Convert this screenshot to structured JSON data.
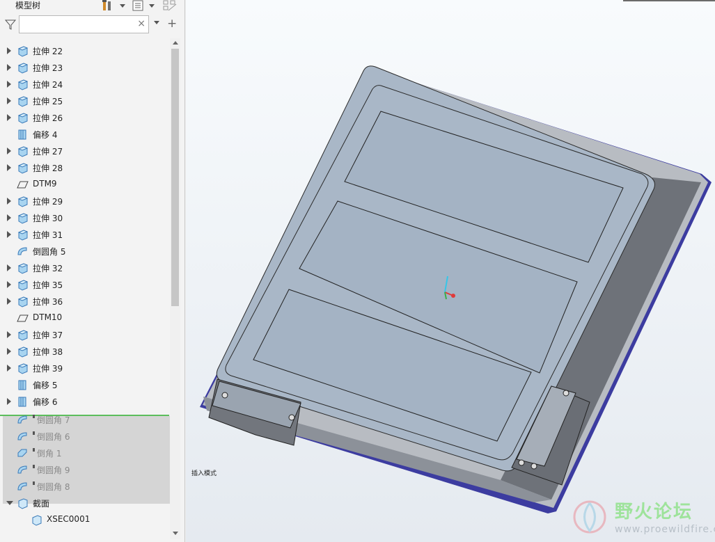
{
  "panel": {
    "title": "模型树",
    "search": {
      "value": "",
      "placeholder": ""
    }
  },
  "tree": [
    {
      "label": "拉伸 22",
      "icon": "extrude-icon",
      "expand": "right"
    },
    {
      "label": "拉伸 23",
      "icon": "extrude-icon",
      "expand": "right"
    },
    {
      "label": "拉伸 24",
      "icon": "extrude-icon",
      "expand": "right"
    },
    {
      "label": "拉伸 25",
      "icon": "extrude-icon",
      "expand": "right"
    },
    {
      "label": "拉伸 26",
      "icon": "extrude-icon",
      "expand": "right"
    },
    {
      "label": "偏移 4",
      "icon": "offset-icon",
      "expand": "none"
    },
    {
      "label": "拉伸 27",
      "icon": "extrude-icon",
      "expand": "right"
    },
    {
      "label": "拉伸 28",
      "icon": "extrude-icon",
      "expand": "right"
    },
    {
      "label": "DTM9",
      "icon": "datum-plane-icon",
      "expand": "none"
    },
    {
      "label": "拉伸 29",
      "icon": "extrude-icon",
      "expand": "right"
    },
    {
      "label": "拉伸 30",
      "icon": "extrude-icon",
      "expand": "right"
    },
    {
      "label": "拉伸 31",
      "icon": "extrude-icon",
      "expand": "right"
    },
    {
      "label": "倒圆角 5",
      "icon": "round-icon",
      "expand": "none"
    },
    {
      "label": "拉伸 32",
      "icon": "extrude-icon",
      "expand": "right"
    },
    {
      "label": "拉伸 35",
      "icon": "extrude-icon",
      "expand": "right"
    },
    {
      "label": "拉伸 36",
      "icon": "extrude-icon",
      "expand": "right"
    },
    {
      "label": "DTM10",
      "icon": "datum-plane-icon",
      "expand": "none"
    },
    {
      "label": "拉伸 37",
      "icon": "extrude-icon",
      "expand": "right"
    },
    {
      "label": "拉伸 38",
      "icon": "extrude-icon",
      "expand": "right"
    },
    {
      "label": "拉伸 39",
      "icon": "extrude-icon",
      "expand": "right"
    },
    {
      "label": "偏移 5",
      "icon": "offset-icon",
      "expand": "none"
    },
    {
      "label": "偏移 6",
      "icon": "offset-icon",
      "expand": "right"
    },
    {
      "label": "倒圆角 7",
      "icon": "round-icon",
      "expand": "none",
      "suppressed": true
    },
    {
      "label": "倒圆角 6",
      "icon": "round-icon",
      "expand": "none",
      "suppressed": true
    },
    {
      "label": "倒角 1",
      "icon": "chamfer-icon",
      "expand": "none",
      "suppressed": true
    },
    {
      "label": "倒圆角 9",
      "icon": "round-icon",
      "expand": "none",
      "suppressed": true
    },
    {
      "label": "倒圆角 8",
      "icon": "round-icon",
      "expand": "none",
      "suppressed": true
    },
    {
      "label": "截面",
      "icon": "section-icon",
      "expand": "down"
    },
    {
      "label": "XSEC0001",
      "icon": "section-icon",
      "expand": "none",
      "indent": true
    }
  ],
  "viewport": {
    "status_text": "插入模式",
    "model_color": "#a9b7c7"
  },
  "watermark": {
    "title": "野火论坛",
    "url": "www.proewildfire.cn"
  }
}
